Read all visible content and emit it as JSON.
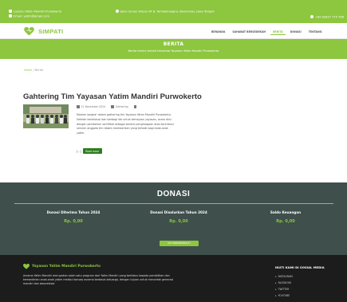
{
  "topbar": {
    "left_line1": "Lazisnu Yatim Mandiri Purwokerto",
    "left_line2": "Email: yatim@gmail.com",
    "address": "Jalan Sunan Ampel 34 B, Tambaknegara, Banyumas, Jawa Tengah",
    "phone": "+62 82837 774 766"
  },
  "navbar": {
    "brand": "SIMPATI",
    "menu": [
      {
        "label": "BERANDA",
        "active": false
      },
      {
        "label": "SAHABAT BERSEDEKAH",
        "active": false
      },
      {
        "label": "BERITA",
        "active": true
      },
      {
        "label": "DONASI",
        "active": false
      },
      {
        "label": "TENTANG",
        "active": false
      }
    ]
  },
  "banner": {
    "title": "BERITA",
    "subtitle": "Berita terkini terkait Informasi Yayasan Yatim Mandiri Purwokerto"
  },
  "breadcrumb": {
    "home": "Home",
    "separator": "/",
    "current": "Berita"
  },
  "post": {
    "title": "Gahtering Tim Yayasan Yatim Mandiri Purwokerto",
    "date": "21 November 2024",
    "category": "Gathering",
    "excerpt": "Momen langka! dalam gathering tim Yayasan Yatim Mandiri Purwokerto. Setelah berdiskusi dan berbagi ide untuk kemajuan yayasan, acara diisi dengan pemberian sertifikat sebagai bentuk penghargaan atas kontribusi seluruh anggota tim dalam memberikan yang terbaik bagi anak-anak yatim.",
    "ellipsis": "[...]",
    "read_more": "Read more"
  },
  "donasi": {
    "title": "DONASI",
    "stats": [
      {
        "label": "Donasi Diterima Tahun 2024",
        "amount": "Rp. 0,00"
      },
      {
        "label": "Donasi Disalurkan Tahun 2024",
        "amount": "Rp. 0,00"
      },
      {
        "label": "Saldo Keuangan",
        "amount": "Rp. 0,00"
      }
    ],
    "button": "AYO BERSEDEKAH !"
  },
  "footer": {
    "brand": "Yayasan Yatim Mandiri Purwokerto",
    "description": "Asrama Yatim Mandiri merupakan salah satu program dari Yatim Mandiri yang berfokus kepada pendidikan dan kemandirian anak-anak yatim melalui konsep asrama berbasis keluarga, dengan tujuan untuk mencetak generasi mandiri dan berprestasi",
    "social_title": "IKUTI KAMI DI SOSIAL MEDIA",
    "social": [
      "INSTAGRAM",
      "FACEBOOK",
      "TWITTER",
      "YOUTUBE"
    ]
  },
  "colors": {
    "brand_green": "#8dc63f",
    "button_dark_green": "#2e7d1f",
    "donasi_bg": "#3f4f4c",
    "footer_bg": "#1c1c1c"
  }
}
